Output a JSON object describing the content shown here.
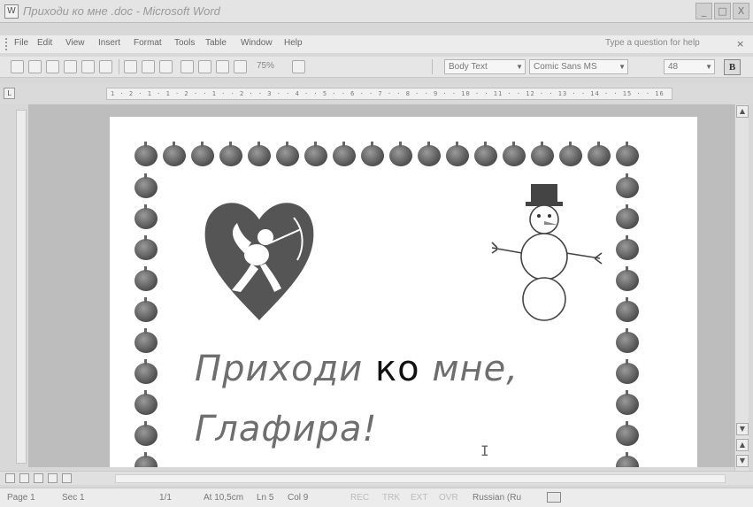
{
  "window": {
    "title": "Приходи ко мне .doc - Microsoft Word",
    "min_glyph": "_",
    "max_glyph": "□",
    "close_glyph": "X"
  },
  "menu": {
    "items": [
      "File",
      "Edit",
      "View",
      "Insert",
      "Format",
      "Tools",
      "Table",
      "Window",
      "Help"
    ],
    "help_placeholder": "Type a question for help",
    "help_close": "× "
  },
  "toolbar": {
    "zoom": "75%",
    "style": "Body Text",
    "font": "Comic Sans MS",
    "size": "48",
    "bold_label": "B"
  },
  "ruler": {
    "text": "1 · 2 · 1 · 1 · 2 · · 1 · · 2 · · 3 · · 4 · · 5 · · 6 · · 7 · · 8 · · 9 · · 10 · · 11 · · 12 · · 13 · · 14 · · 15 · · 16"
  },
  "document": {
    "line1_part1": "Приходи",
    "line1_part2": "ко",
    "line1_part3": "мне,",
    "line2": "Глафира!"
  },
  "status": {
    "page": "Page 1",
    "sec": "Sec 1",
    "pages": "1/1",
    "at": "At 10,5cm",
    "ln": "Ln 5",
    "col": "Col 9",
    "rec": "REC",
    "trk": "TRK",
    "ext": "EXT",
    "ovr": "OVR",
    "language": "Russian (Ru"
  },
  "icons": [
    "word-app-icon",
    "grip-icon",
    "new-icon",
    "open-icon",
    "save-icon",
    "print-icon",
    "undo-icon",
    "redo-icon",
    "table-icon",
    "pilcrow-icon",
    "bold-icon",
    "heart-cupid-icon",
    "snowman-icon",
    "cursor-ibeam-icon",
    "spell-check-icon"
  ]
}
